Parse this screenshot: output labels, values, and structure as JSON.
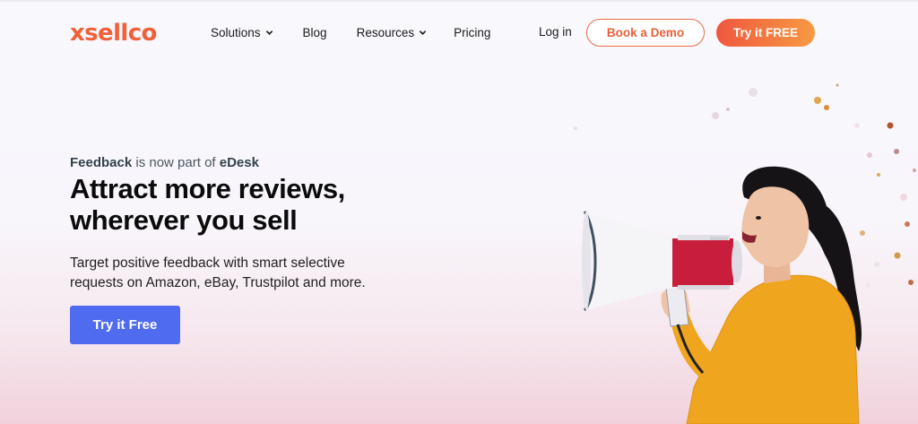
{
  "brand": {
    "logo_text": "xsellco",
    "accent_color": "#f0603a"
  },
  "nav": {
    "items": [
      {
        "label": "Solutions",
        "has_dropdown": true
      },
      {
        "label": "Blog",
        "has_dropdown": false
      },
      {
        "label": "Resources",
        "has_dropdown": true
      },
      {
        "label": "Pricing",
        "has_dropdown": false
      }
    ],
    "login_label": "Log in",
    "demo_label": "Book a Demo",
    "try_label": "Try it FREE"
  },
  "hero": {
    "eyebrow_strong1": "Feedback",
    "eyebrow_mid": " is now part of ",
    "eyebrow_strong2": "eDesk",
    "headline_line1": "Attract more reviews,",
    "headline_line2": "wherever you sell",
    "subtext_line1": "Target positive feedback with smart selective",
    "subtext_line2": "requests on Amazon, eBay, Trustpilot and more.",
    "cta_label": "Try it Free",
    "cta_color": "#4f6cf0",
    "image_icon": "woman-with-megaphone-illustration"
  }
}
